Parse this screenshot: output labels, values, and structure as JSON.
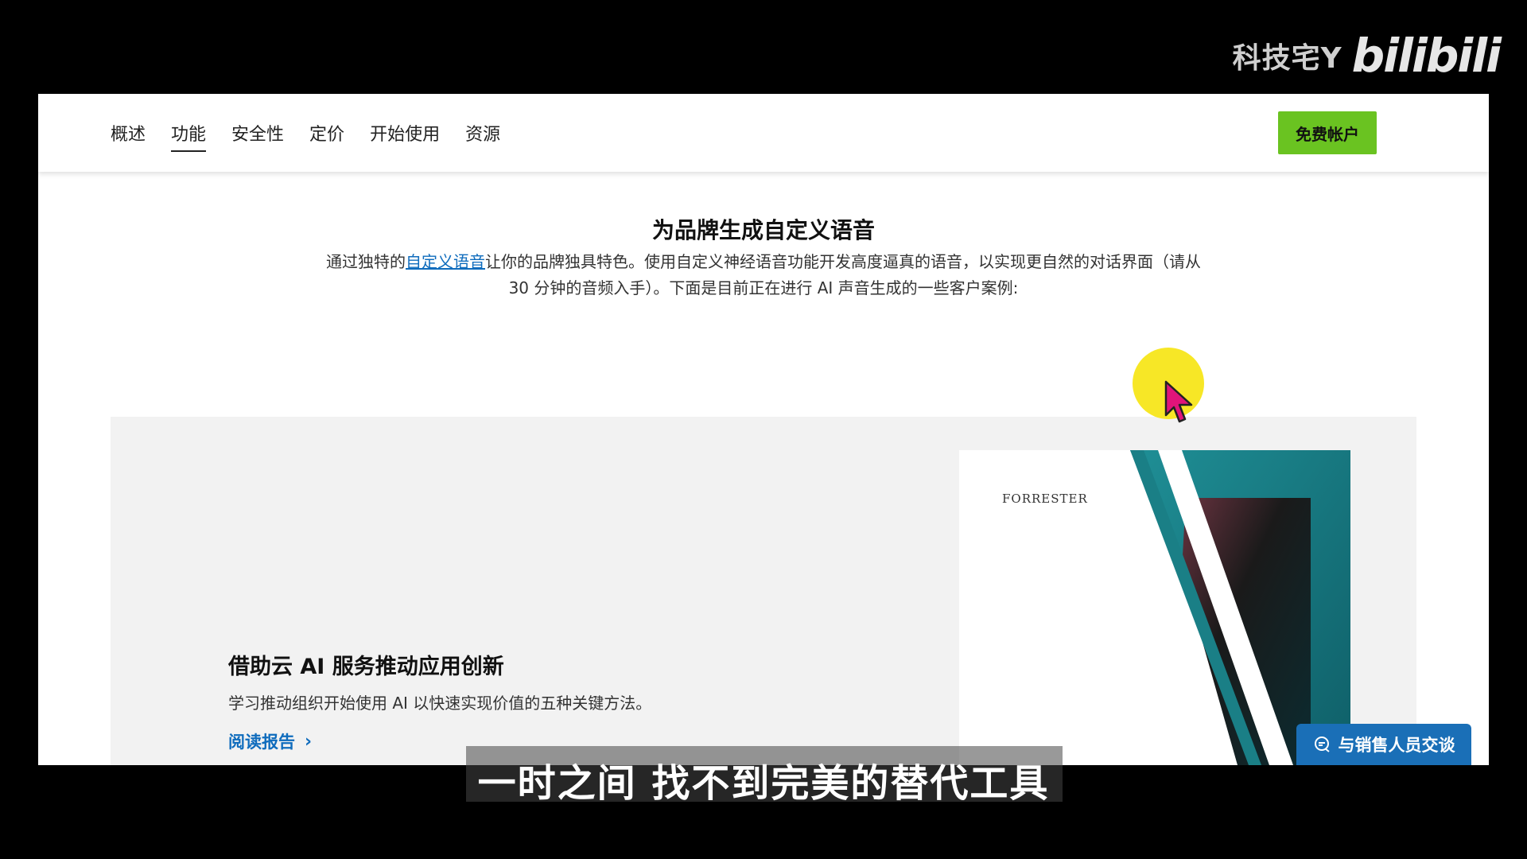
{
  "watermark": {
    "author": "科技宅Y",
    "logo": "bilibili"
  },
  "nav": {
    "items": [
      {
        "label": "概述"
      },
      {
        "label": "功能"
      },
      {
        "label": "安全性"
      },
      {
        "label": "定价"
      },
      {
        "label": "开始使用"
      },
      {
        "label": "资源"
      }
    ],
    "active": "功能",
    "cta_label": "免费帐户"
  },
  "section": {
    "title": "为品牌生成自定义语音",
    "desc_prefix": "通过独特的",
    "desc_link": "自定义语音",
    "desc_suffix": "让你的品牌独具特色。使用自定义神经语音功能开发高度逼真的语音，以实现更自然的对话界面（请从 30 分钟的音频入手）。下面是目前正在进行 AI 声音生成的一些客户案例:"
  },
  "card": {
    "title": "借助云 AI 服务推动应用创新",
    "desc": "学习推动组织开始使用 AI 以快速实现价值的五种关键方法。",
    "link": "阅读报告",
    "image_brand": "FORRESTER"
  },
  "chat_button": {
    "label": "与销售人员交谈",
    "icon": "chat-icon"
  },
  "subtitle": "一时之间  找不到完美的替代工具",
  "colors": {
    "cta": "#6ac321",
    "link": "#0f6cbd",
    "chat": "#1a6fb7",
    "highlight": "#f7e61a",
    "cursor": "#e0147a"
  }
}
